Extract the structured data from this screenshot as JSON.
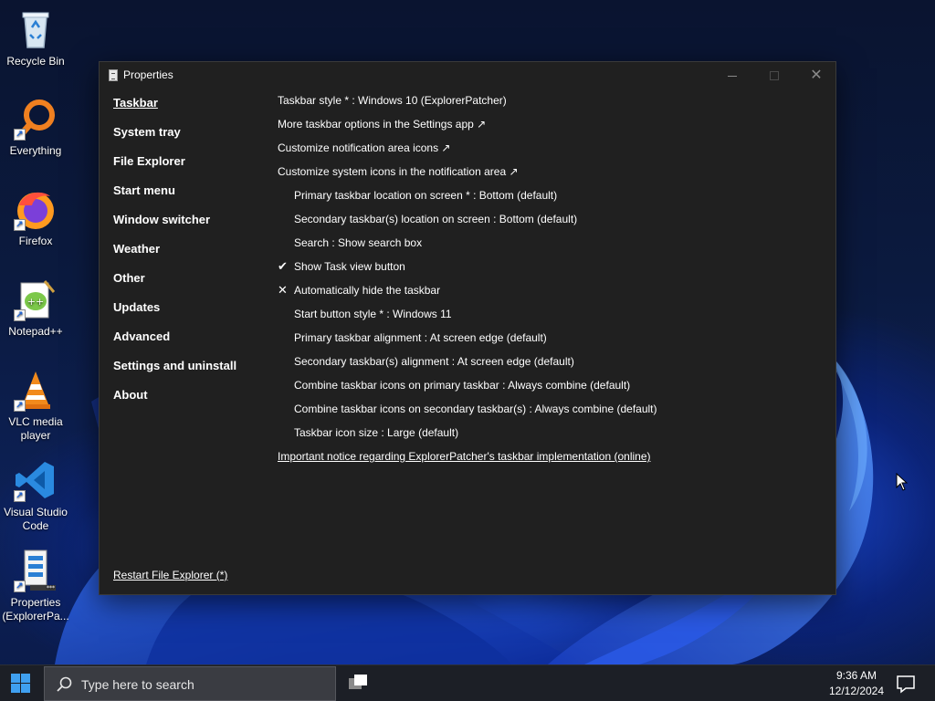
{
  "desktop": {
    "icons": [
      {
        "label": "Recycle Bin",
        "icon": "recycle-bin-icon"
      },
      {
        "label": "Everything",
        "icon": "magnifier-icon"
      },
      {
        "label": "Firefox",
        "icon": "firefox-icon"
      },
      {
        "label": "Notepad++",
        "icon": "notepadpp-icon"
      },
      {
        "label": "VLC media player",
        "icon": "vlc-cone-icon"
      },
      {
        "label": "Visual Studio Code",
        "icon": "vscode-icon"
      },
      {
        "label": "Properties (ExplorerPa...",
        "icon": "properties-icon"
      }
    ]
  },
  "window": {
    "title": "Properties",
    "controls": {
      "minimize": "—",
      "maximize": "☐",
      "close": "✕"
    },
    "sidebar": {
      "items": [
        {
          "label": "Taskbar",
          "active": true
        },
        {
          "label": "System tray"
        },
        {
          "label": "File Explorer"
        },
        {
          "label": "Start menu"
        },
        {
          "label": "Window switcher"
        },
        {
          "label": "Weather"
        },
        {
          "label": "Other"
        },
        {
          "label": "Updates"
        },
        {
          "label": "Advanced"
        },
        {
          "label": "Settings and uninstall"
        },
        {
          "label": "About"
        }
      ],
      "restart_link": "Restart File Explorer (*)"
    },
    "options": [
      {
        "text": "Taskbar style * : Windows 10 (ExplorerPatcher)",
        "indent": false,
        "mark": ""
      },
      {
        "text": "More taskbar options in the Settings app ↗",
        "indent": false,
        "mark": ""
      },
      {
        "text": "Customize notification area icons ↗",
        "indent": false,
        "mark": ""
      },
      {
        "text": "Customize system icons in the notification area ↗",
        "indent": false,
        "mark": ""
      },
      {
        "text": "Primary taskbar location on screen * : Bottom (default)",
        "indent": true,
        "mark": ""
      },
      {
        "text": "Secondary taskbar(s) location on screen : Bottom (default)",
        "indent": true,
        "mark": ""
      },
      {
        "text": "Search : Show search box",
        "indent": true,
        "mark": ""
      },
      {
        "text": "Show Task view button",
        "indent": true,
        "mark": "✔"
      },
      {
        "text": "Automatically hide the taskbar",
        "indent": true,
        "mark": "✕"
      },
      {
        "text": "Start button style * : Windows 11",
        "indent": true,
        "mark": ""
      },
      {
        "text": "Primary taskbar alignment : At screen edge (default)",
        "indent": true,
        "mark": ""
      },
      {
        "text": "Secondary taskbar(s) alignment : At screen edge (default)",
        "indent": true,
        "mark": ""
      },
      {
        "text": "Combine taskbar icons on primary taskbar : Always combine (default)",
        "indent": true,
        "mark": ""
      },
      {
        "text": "Combine taskbar icons on secondary taskbar(s) : Always combine (default)",
        "indent": true,
        "mark": ""
      },
      {
        "text": "Taskbar icon size : Large (default)",
        "indent": true,
        "mark": ""
      },
      {
        "text": "Important notice regarding ExplorerPatcher's taskbar implementation (online)",
        "indent": false,
        "mark": "",
        "link": true
      }
    ]
  },
  "taskbar": {
    "search_placeholder": "Type here to search",
    "time": "9:36 AM",
    "date": "12/12/2024"
  },
  "colors": {
    "window_bg": "#202020",
    "taskbar_bg": "#1c1f26",
    "start_blue": "#3fa0f0"
  }
}
